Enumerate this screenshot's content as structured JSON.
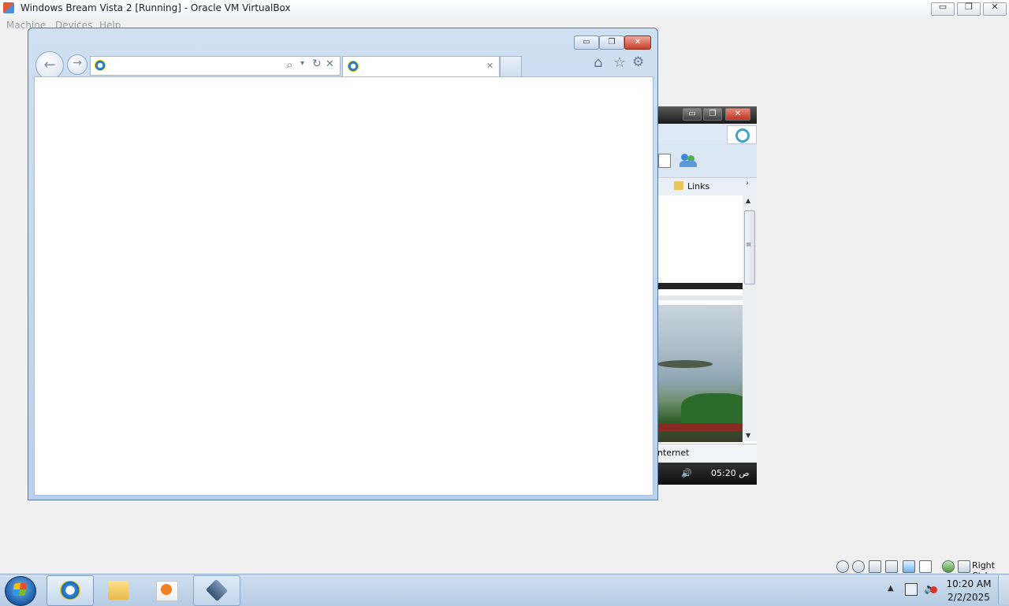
{
  "vbox": {
    "title": "Windows Bream Vista 2 [Running] - Oracle VM VirtualBox",
    "menu": [
      "Machine",
      "Devices",
      "Help"
    ],
    "controls": {
      "minimize": "▭",
      "restore": "❐",
      "close": "✕"
    },
    "host_key": "Right Ctrl",
    "status_icons": [
      "hard-disk-icon",
      "optical-drive-icon",
      "usb-icon",
      "shared-folders-icon",
      "display-icon",
      "video-capture-icon",
      "mouse-integration-icon",
      "host-key-icon"
    ]
  },
  "ie": {
    "controls": {
      "minimize": "▭",
      "restore": "❐",
      "close": "✕"
    },
    "back_glyph": "←",
    "forward_glyph": "→",
    "address_value": "",
    "search_glyph": "⌕",
    "dropdown_glyph": "▾",
    "refresh_glyph": "↻",
    "stop_glyph": "✕",
    "tab_title": "",
    "tab_close_glyph": "✕",
    "home_glyph": "⌂",
    "favorites_glyph": "☆",
    "tools_glyph": "⚙"
  },
  "background_window": {
    "controls": {
      "minimize": "▭",
      "restore": "❐",
      "close": "✕"
    },
    "links_label": "Links",
    "links_chevron": "›",
    "status_text": "nternet",
    "clock": "ص 05:20",
    "scroll_up": "▲",
    "scroll_down": "▼",
    "scroll_grip": "≡"
  },
  "taskbar": {
    "pinned": [
      {
        "name": "internet-explorer",
        "active": true
      },
      {
        "name": "windows-explorer",
        "active": false
      },
      {
        "name": "windows-media-player",
        "active": false
      },
      {
        "name": "virtualbox",
        "active": true
      }
    ],
    "tray_chevron": "▲",
    "clock_time": "10:20 AM",
    "clock_date": "2/2/2025"
  },
  "colors": {
    "taskbar": "#c4d8ee",
    "ie_frame": "#b9d1ea",
    "ie_close": "#c6402b"
  }
}
